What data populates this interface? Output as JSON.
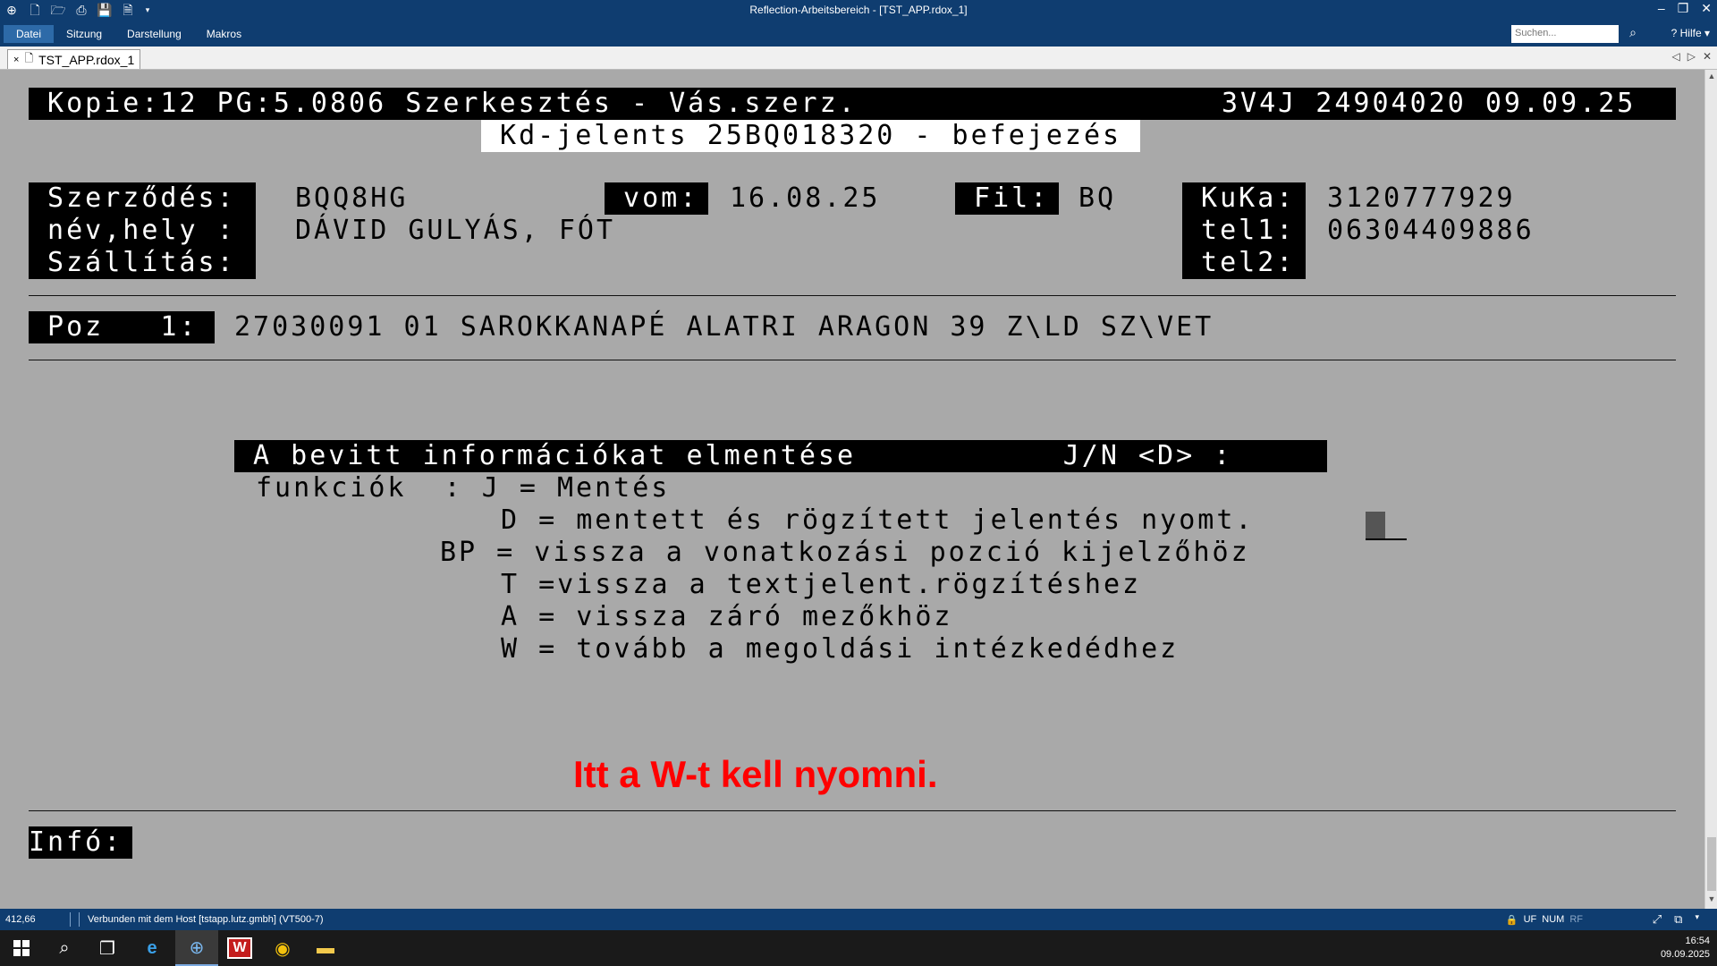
{
  "window": {
    "title": "Reflection-Arbeitsbereich - [TST_APP.rdox_1]",
    "quick_access_icons": [
      "app-icon",
      "new-icon",
      "open-icon",
      "print-icon",
      "save-icon",
      "document-icon"
    ]
  },
  "menu": {
    "items": [
      "Datei",
      "Sitzung",
      "Darstellung",
      "Makros"
    ],
    "search_placeholder": "Suchen...",
    "help": "Hilfe"
  },
  "tab": {
    "close": "×",
    "label": "TST_APP.rdox_1"
  },
  "terminal": {
    "header_left": " Kopie:12 PG:5.0806 Szerkesztés - Vás.szerz.",
    "header_right": "3V4J 24904020 09.09.25 ",
    "subtitle": " Kd-jelents 25BQ018320 - befejezés ",
    "label_szerzodes": " Szerződés:",
    "label_nevhely": " név,hely :",
    "label_szallitas": " Szállítás:",
    "value_szerzodes": "BQQ8HG",
    "value_nevhely": "DÁVID GULYÁS, FÓT",
    "label_vom": " vom:",
    "value_vom": "16.08.25",
    "label_fil": " Fil:",
    "value_fil": "BQ",
    "label_kuka": " KuKa:",
    "label_tel1": " tel1:",
    "label_tel2": " tel2:",
    "value_kuka": "3120777929",
    "value_tel1": "06304409886",
    "label_poz": " Poz   1:",
    "value_poz": "27030091 01 SAROKKANAPÉ ALATRI ARAGON 39 Z\\LD SZ\\VET",
    "prompt": " A bevitt információkat elmentése           J/N <D> : ",
    "functions": [
      "funkciók  : J = Mentés",
      "D = mentett és rögzített jelentés nyomt.",
      "BP = vissza a vonatkozási pozció kijelzőhöz",
      "T =vissza a textjelent.rögzítéshez",
      "A = vissza záró mezőkhöz",
      "W = tovább a megoldási intézkedédhez"
    ],
    "info_label": "Infó:"
  },
  "annotation": "Itt a W-t kell nyomni.",
  "status": {
    "position": "412,66",
    "connection": "Verbunden mit dem Host [tstapp.lutz.gmbh] (VT500-7)",
    "indicators": [
      "UF",
      "NUM",
      "RF"
    ]
  },
  "taskbar": {
    "time": "16:54",
    "date": "09.09.2025"
  }
}
